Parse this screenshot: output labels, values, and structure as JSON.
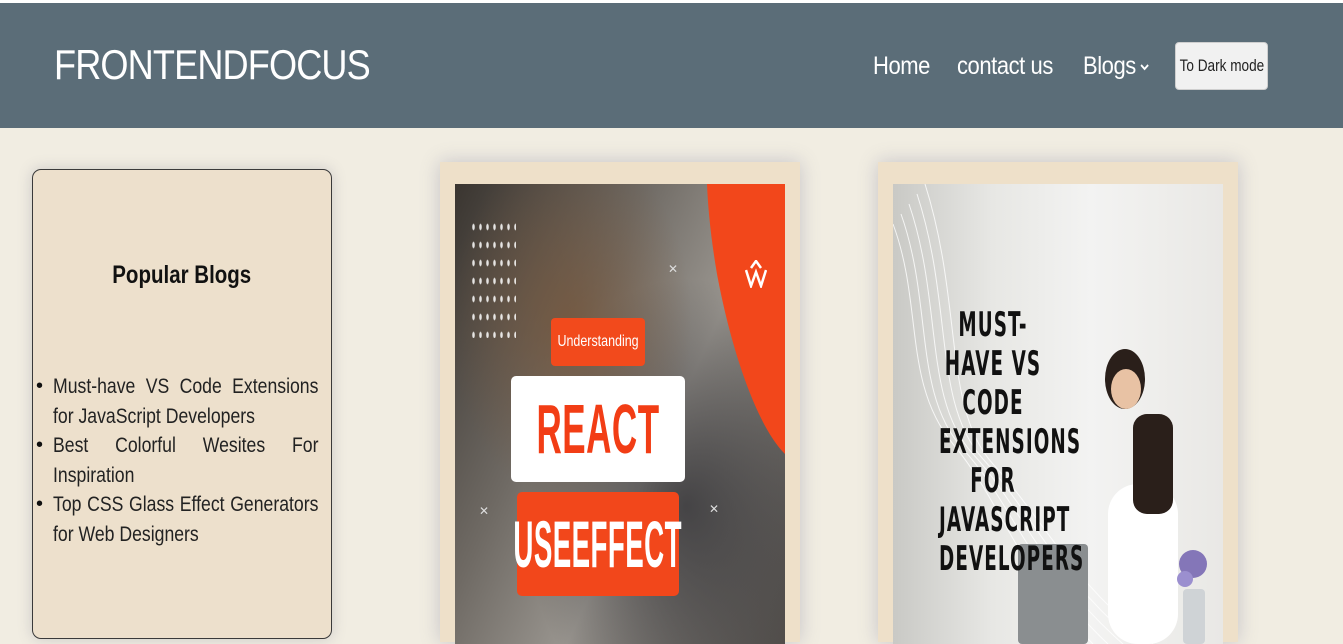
{
  "header": {
    "brand": "FRONTENDFOCUS",
    "nav": {
      "home": "Home",
      "contact": "contact us",
      "blogs": "Blogs",
      "blogs_chevron": "chevron-down-icon"
    },
    "dark_mode_button": "To Dark mode"
  },
  "sidebar": {
    "title": "Popular Blogs",
    "items": [
      "Must-have VS Code Extensions for JavaScript Developers",
      "Best Colorful Wesites For Inspiration",
      "Top CSS Glass Effect Generators for Web Designers"
    ]
  },
  "cards": [
    {
      "chip": "Understanding",
      "line1": "REACT",
      "line2": "USEEFFECT"
    },
    {
      "headline": "MUST-HAVE VS CODE EXTENSIONS FOR JAVASCRIPT DEVELOPERS"
    }
  ],
  "colors": {
    "header_bg": "#5b6d78",
    "page_bg": "#f1ede2",
    "card_bg": "#eee0c9",
    "accent_orange": "#f2471b"
  }
}
